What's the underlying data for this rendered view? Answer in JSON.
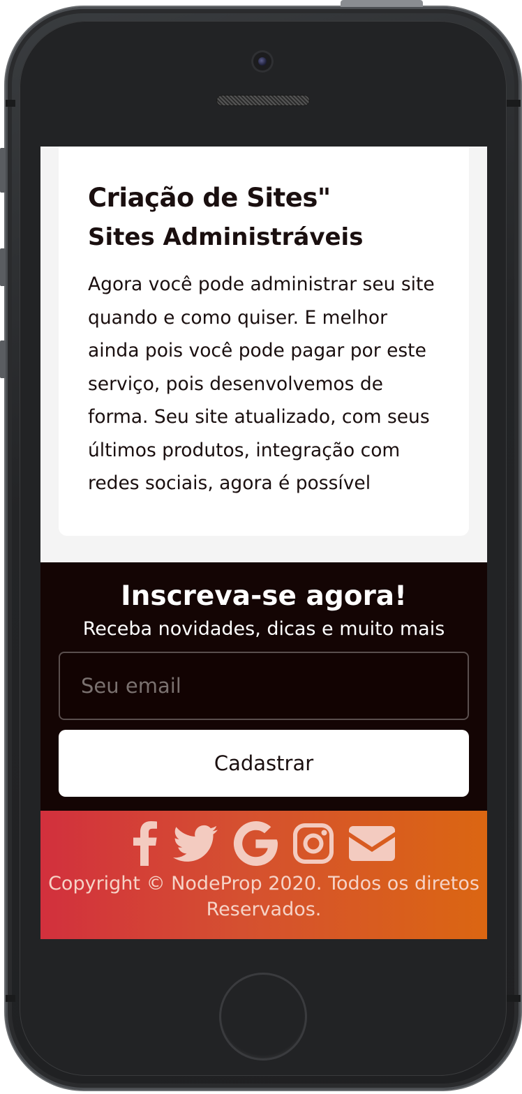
{
  "card": {
    "title": "Criação de Sites\"",
    "subtitle": "Sites Administráveis",
    "text": "Agora você pode administrar seu site quando e como quiser. E melhor ainda pois você pode pagar por este serviço, pois desenvolvemos de forma. Seu site atualizado, com seus últimos produtos, integração com redes sociais, agora é possível"
  },
  "subscribe": {
    "title": "Inscreva-se agora!",
    "subtitle": "Receba novidades, dicas e muito mais",
    "email_placeholder": "Seu email",
    "email_value": "",
    "button_label": "Cadastrar"
  },
  "footer": {
    "social": [
      "facebook-icon",
      "twitter-icon",
      "google-icon",
      "instagram-icon",
      "envelope-icon"
    ],
    "copyright": "Copyright © NodeProp 2020. Todos os diretos Reservados."
  },
  "colors": {
    "dark_section": "#140504",
    "footer_gradient_start": "#d2303d",
    "footer_gradient_end": "#db6612",
    "icon_color": "#f3cbc0"
  }
}
